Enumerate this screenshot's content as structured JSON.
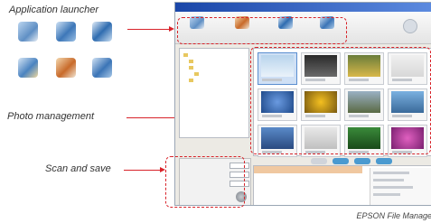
{
  "callouts": {
    "launcher": "Application launcher",
    "photo": "Photo management",
    "scan": "Scan and save"
  },
  "caption": "EPSON File Manager",
  "launcher_icons": [
    "scanner-icon",
    "edit-photo-icon",
    "print-icon",
    "scan-to-web-icon",
    "album-icon",
    "share-icon"
  ],
  "accent_color": "#d8232a"
}
